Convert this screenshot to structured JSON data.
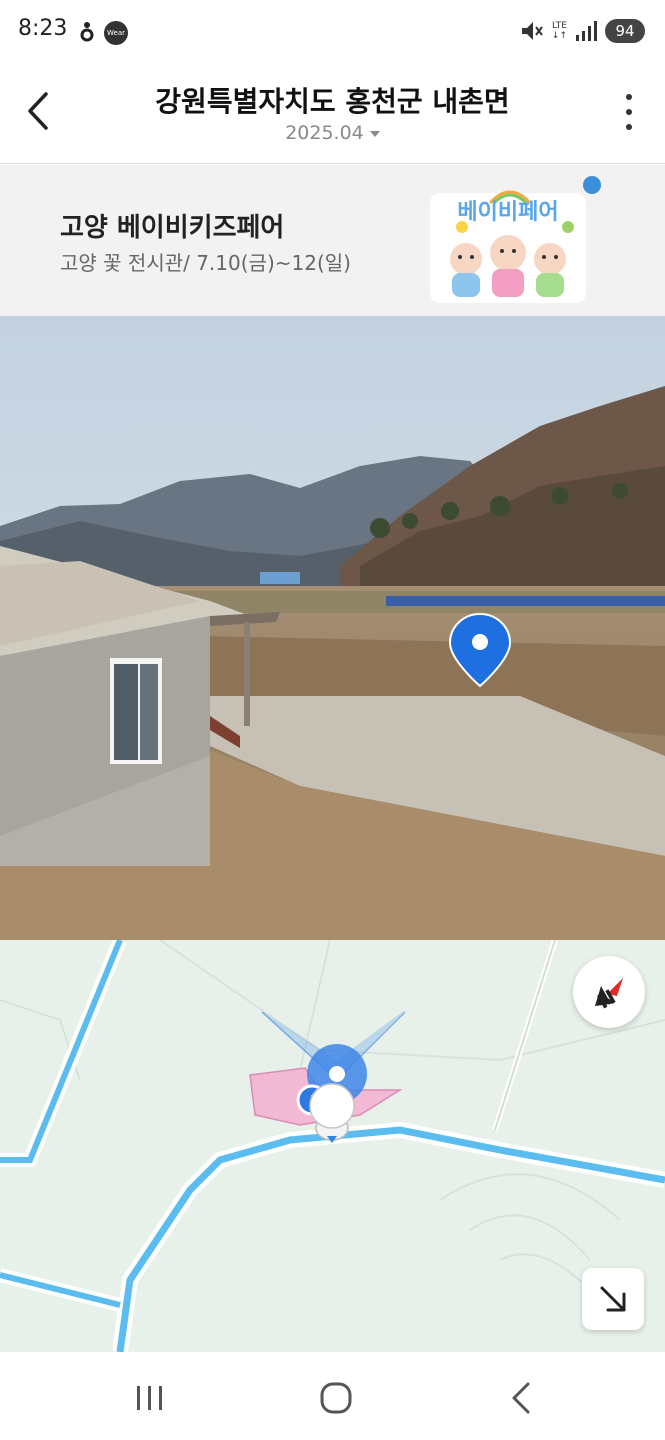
{
  "status_bar": {
    "time": "8:23",
    "wear_badge": "Wear",
    "network": "LTE",
    "battery": "94",
    "icons": [
      "notification-dot-icon",
      "mute-icon",
      "signal-icon"
    ]
  },
  "header": {
    "title": "강원특별자치도 홍천군 내촌면",
    "date": "2025.04",
    "icons": [
      "back-arrow-icon",
      "more-vertical-icon"
    ]
  },
  "ad": {
    "title": "고양 베이비키즈페어",
    "subtitle": "고양 꽃 전시관/ 7.10(금)~12(일)",
    "art_text": "베이비페어"
  },
  "streetview": {
    "marker_color": "#1e6fe0"
  },
  "map": {
    "road_color": "#5bbcf0",
    "area_color": "#f1b9d3",
    "icons": [
      "compass-icon",
      "expand-icon",
      "current-location-icon"
    ]
  },
  "nav": {
    "icons": [
      "recent-apps-icon",
      "home-icon",
      "back-icon"
    ]
  }
}
